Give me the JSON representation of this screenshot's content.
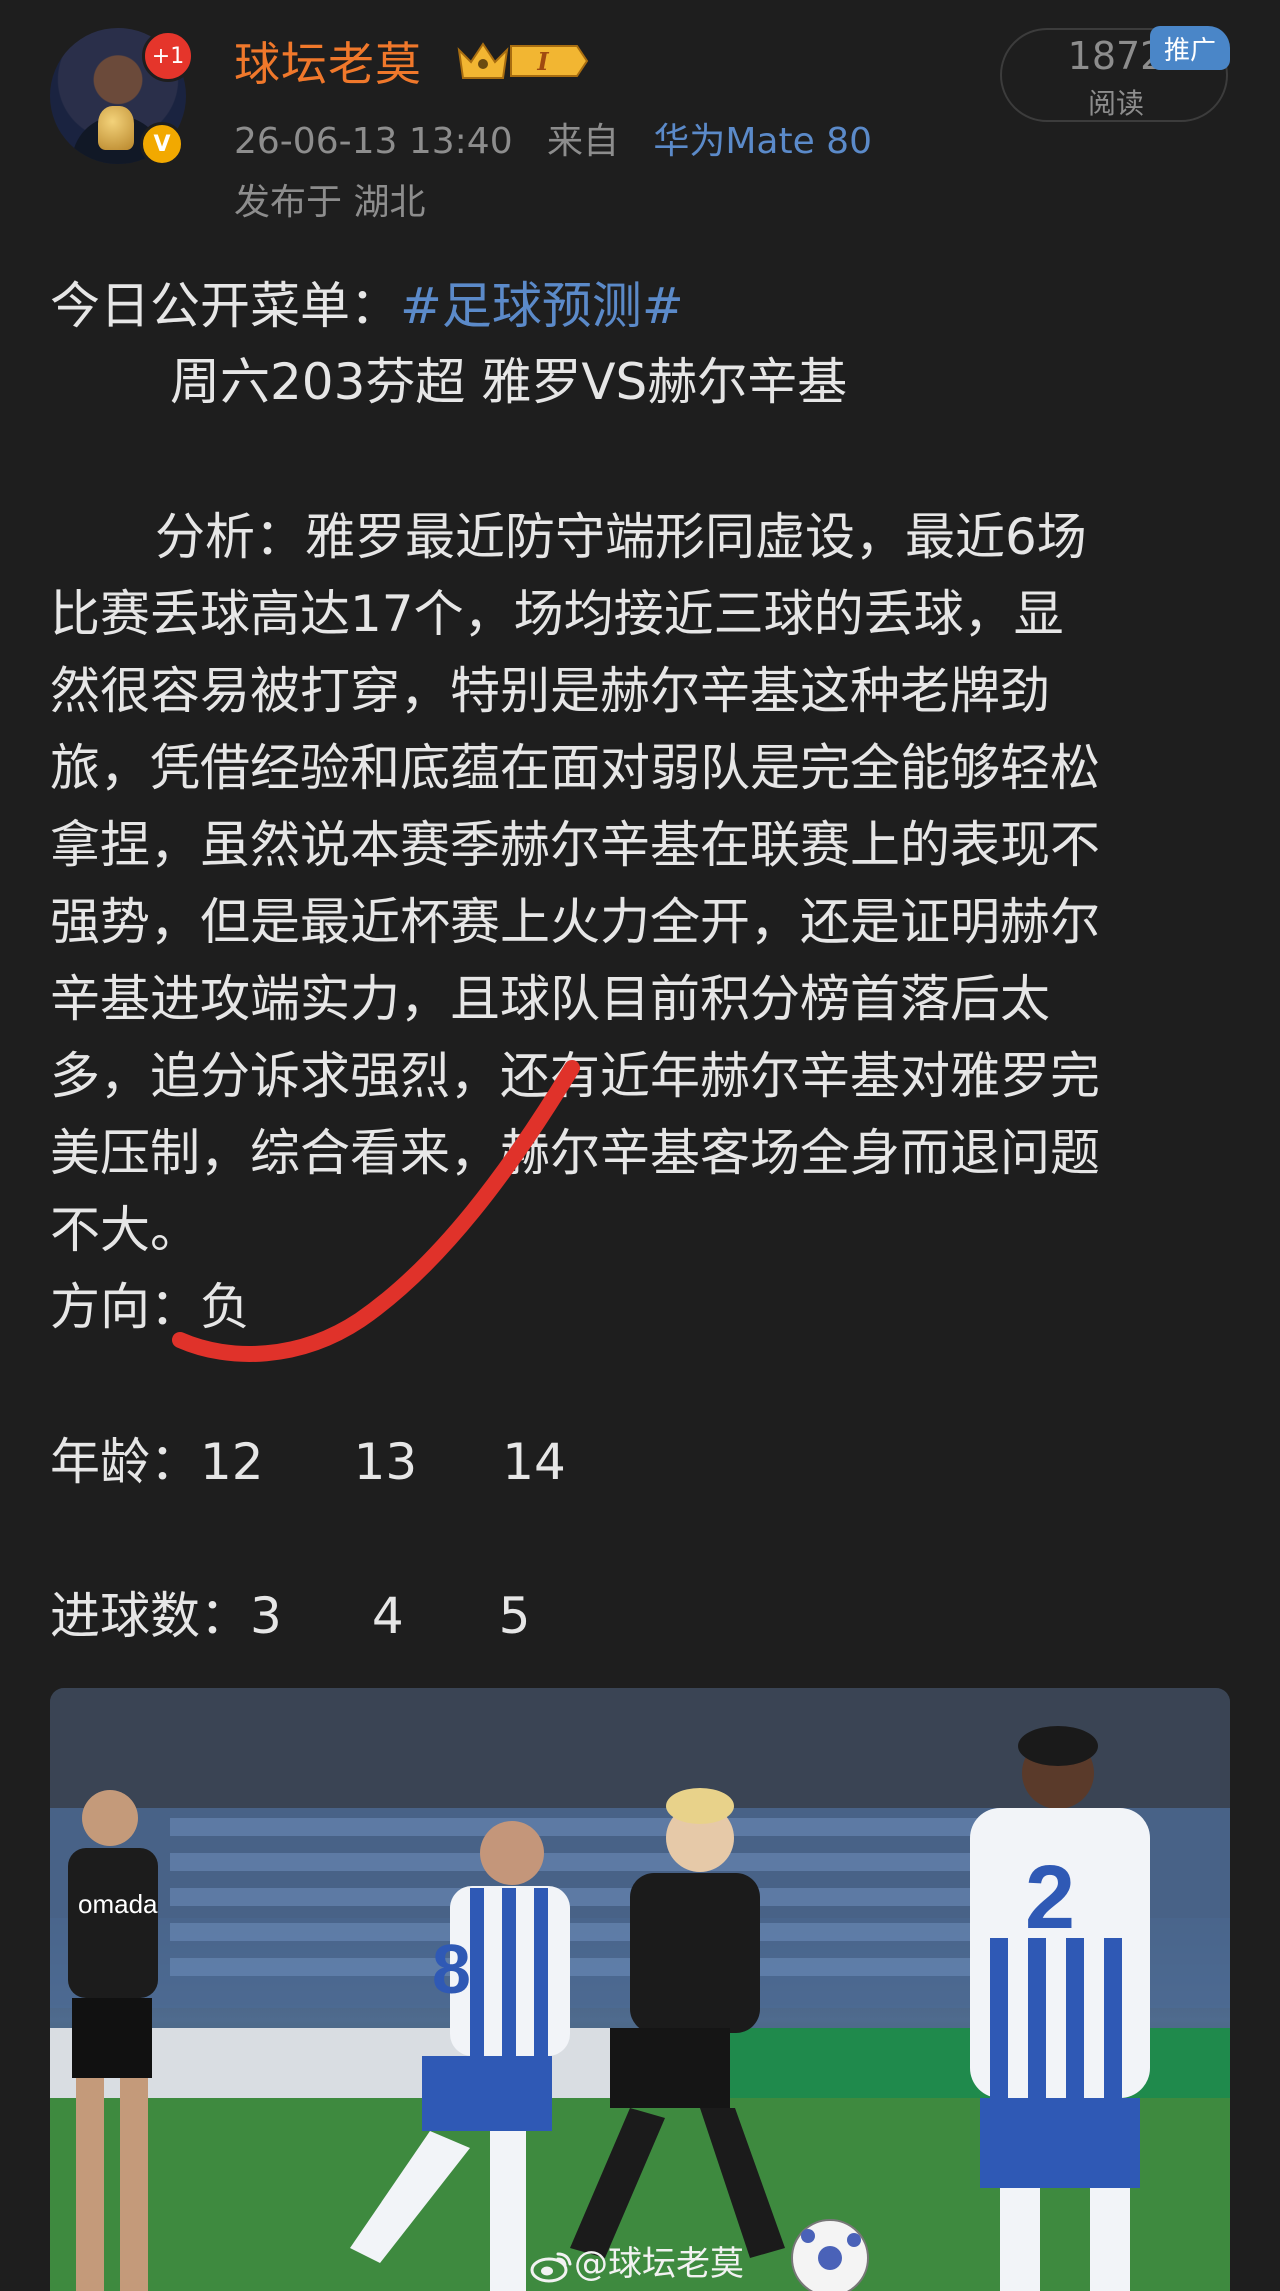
{
  "header": {
    "username": "球坛老莫",
    "crown_badge_text": "I",
    "avatar_badge": "+1",
    "verified_badge": "V",
    "timestamp": "26-06-13 13:40",
    "source_prefix": "来自",
    "device": "华为Mate 80",
    "location": "发布于 湖北",
    "read_count": "1872",
    "read_label": "阅读",
    "promo_tag": "推广"
  },
  "post": {
    "intro_prefix": "今日公开菜单：",
    "hashtag": "#足球预测#",
    "match": "周六203芬超 雅罗VS赫尔辛基",
    "analysis_lines": [
      "分析：雅罗最近防守端形同虚设，最近6场",
      "比赛丢球高达17个，场均接近三球的丢球，显",
      "然很容易被打穿，特别是赫尔辛基这种老牌劲",
      "旅，凭借经验和底蕴在面对弱队是完全能够轻松",
      "拿捏，虽然说本赛季赫尔辛基在联赛上的表现不",
      "强势，但是最近杯赛上火力全开，还是证明赫尔",
      "辛基进攻端实力，且球队目前积分榜首落后太",
      "多，追分诉求强烈，还有近年赫尔辛基对雅罗完",
      "美压制，综合看来，赫尔辛基客场全身而退问题",
      "不大。"
    ],
    "direction_label": "方向：",
    "direction_value": "负",
    "age_label": "年龄：",
    "age_values": [
      "12",
      "13",
      "14"
    ],
    "goals_label": "进球数：",
    "goals_values": [
      "3",
      "4",
      "5"
    ]
  },
  "photo": {
    "jersey_number_left": "8",
    "jersey_number_right": "2",
    "sponsor_text": "omada",
    "watermark": "@球坛老莫"
  },
  "colors": {
    "background": "#1e1e1e",
    "username": "#f0782b",
    "link_blue": "#5b8ac9",
    "meta_gray": "#8d8d8d",
    "annotation_red": "#e0322a"
  }
}
